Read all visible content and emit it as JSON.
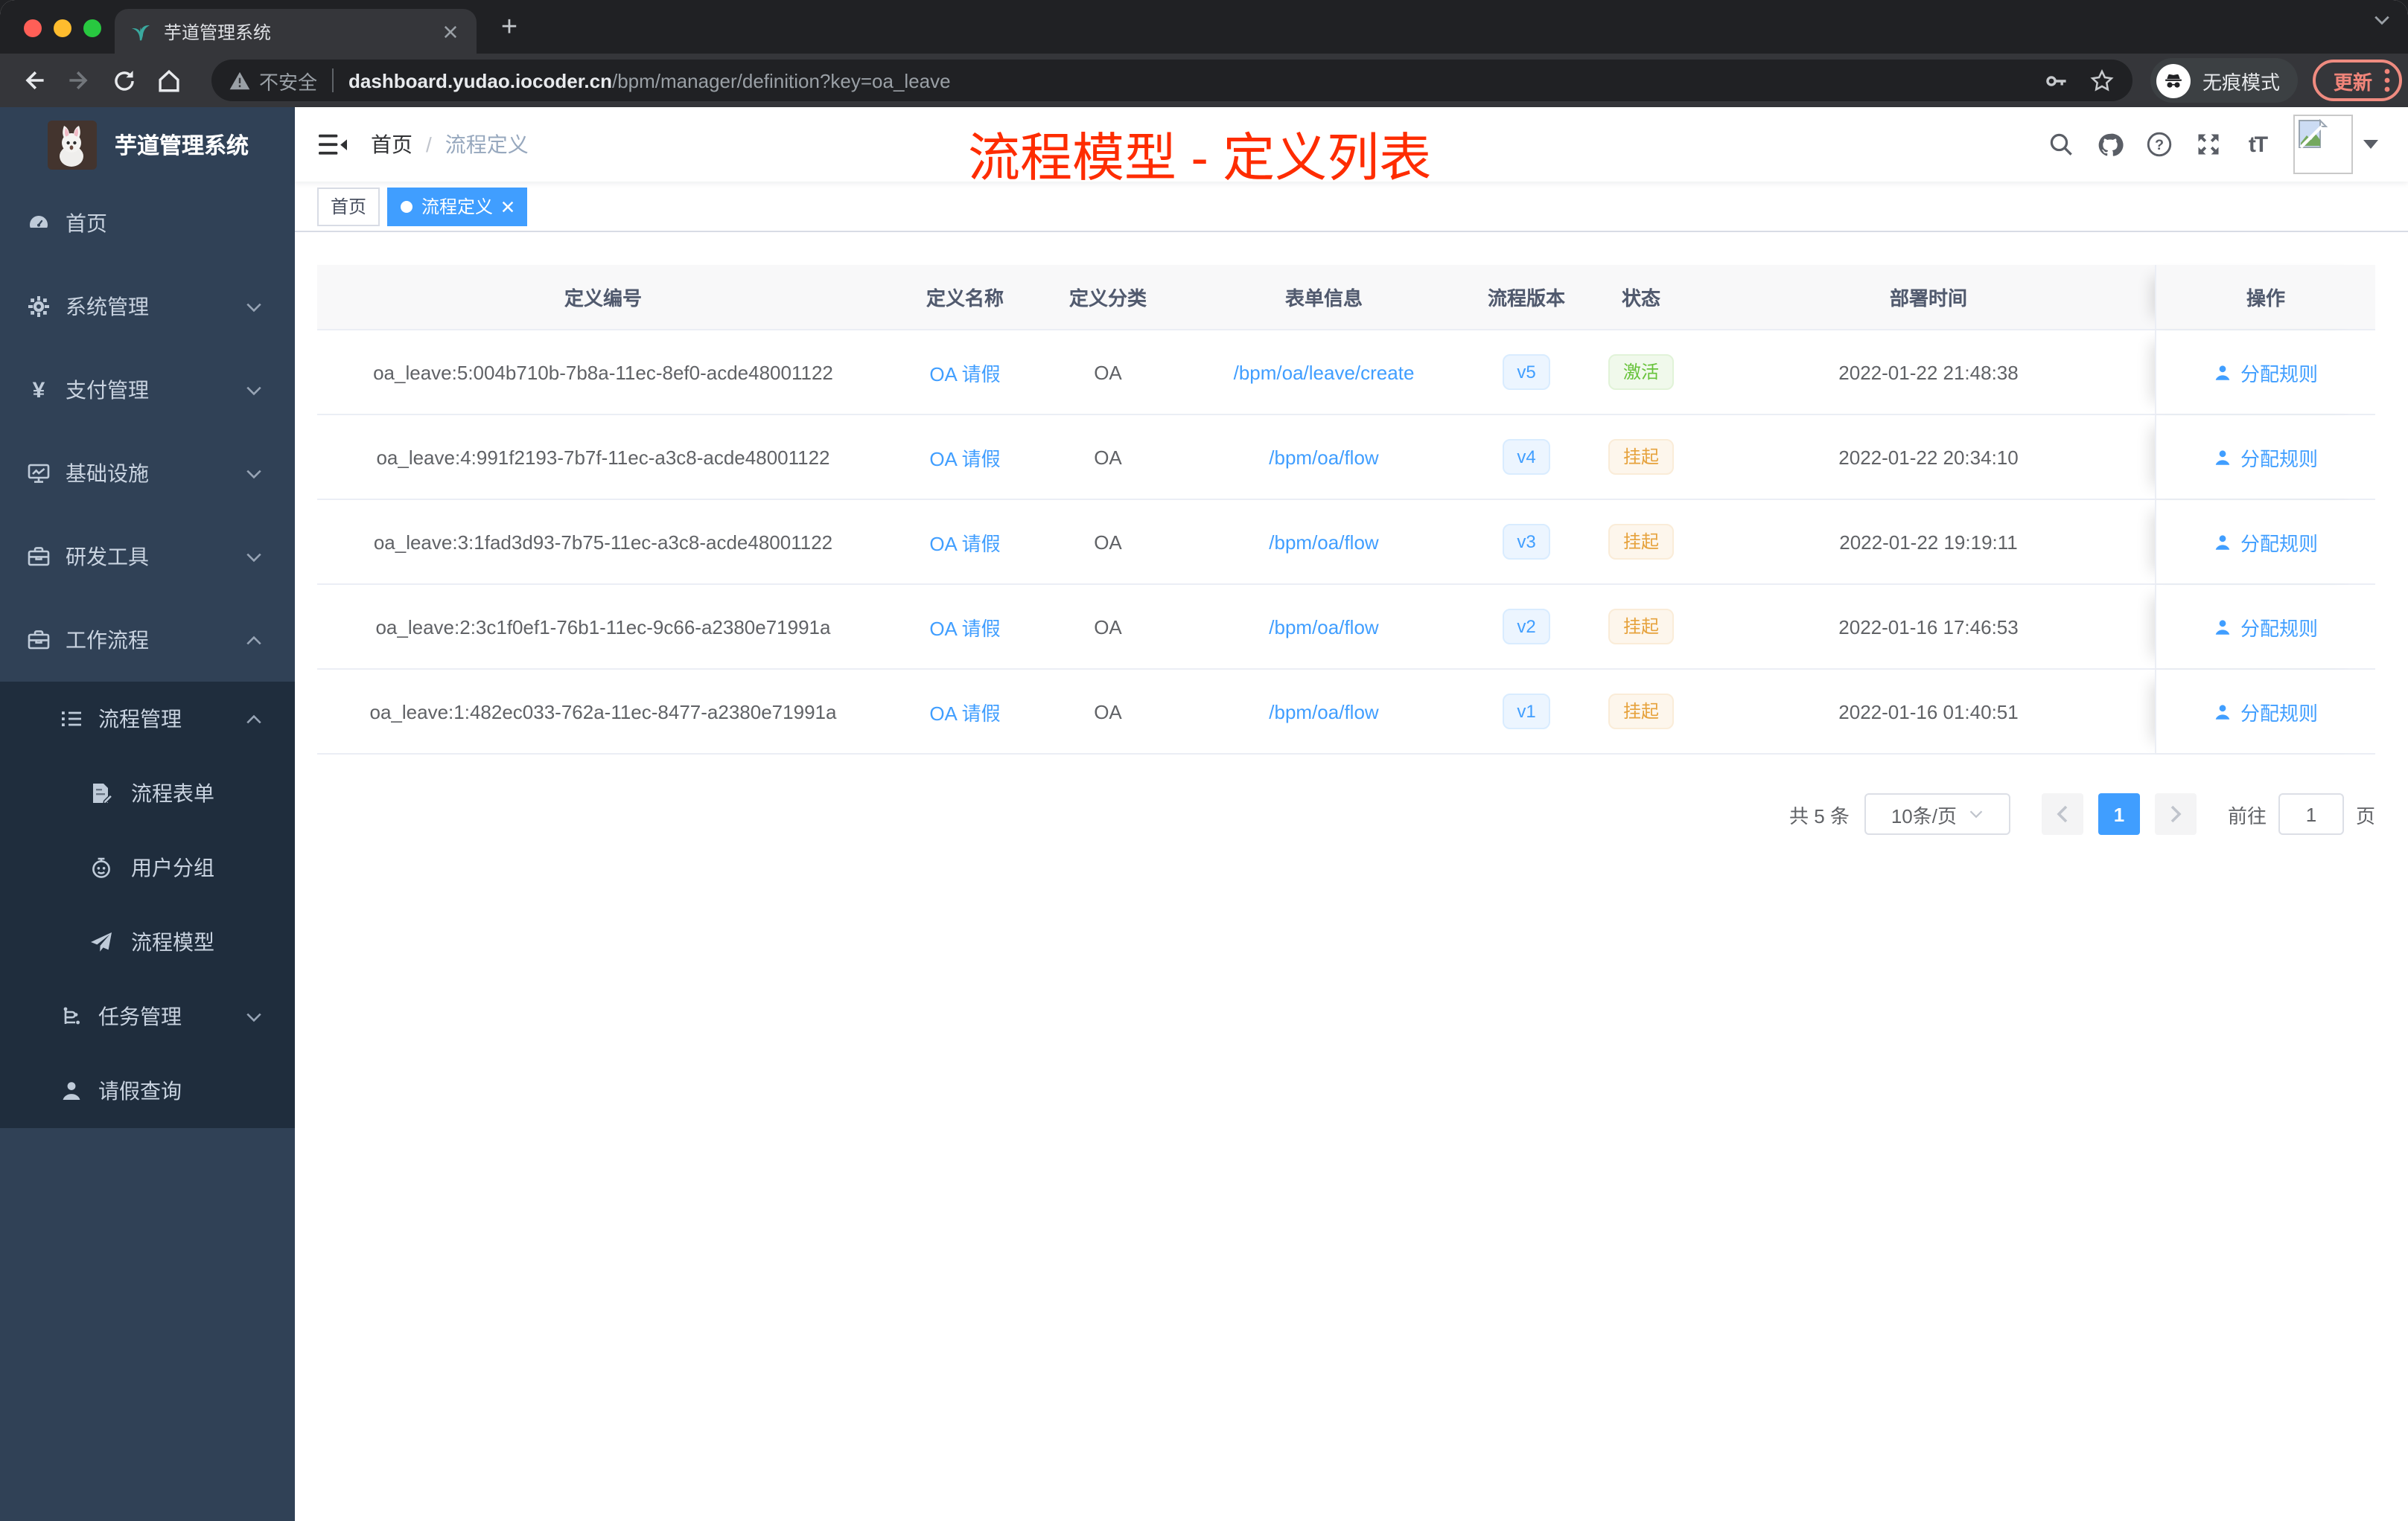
{
  "browser": {
    "tab_title": "芋道管理系统",
    "security_label": "不安全",
    "url_domain": "dashboard.yudao.iocoder.cn",
    "url_path": "/bpm/manager/definition?key=oa_leave",
    "incognito_label": "无痕模式",
    "update_label": "更新"
  },
  "sidebar": {
    "app_title": "芋道管理系统",
    "items": [
      {
        "label": "首页",
        "icon": "dashboard-icon"
      },
      {
        "label": "系统管理",
        "icon": "gear-icon",
        "expand": "down"
      },
      {
        "label": "支付管理",
        "icon": "yen-icon",
        "expand": "down"
      },
      {
        "label": "基础设施",
        "icon": "monitor-icon",
        "expand": "down"
      },
      {
        "label": "研发工具",
        "icon": "toolbox-icon",
        "expand": "down"
      },
      {
        "label": "工作流程",
        "icon": "briefcase-icon",
        "expand": "up"
      }
    ],
    "workflow_children": [
      {
        "label": "流程管理",
        "icon": "list-icon",
        "expand": "up"
      },
      {
        "label": "流程表单",
        "icon": "form-icon"
      },
      {
        "label": "用户分组",
        "icon": "robot-icon"
      },
      {
        "label": "流程模型",
        "icon": "paper-plane-icon"
      },
      {
        "label": "任务管理",
        "icon": "tree-icon",
        "expand": "down"
      },
      {
        "label": "请假查询",
        "icon": "user-icon"
      }
    ]
  },
  "navbar": {
    "breadcrumb_home": "首页",
    "breadcrumb_sep": "/",
    "breadcrumb_current": "流程定义",
    "font_icon_label": "tT"
  },
  "annotation": {
    "text": "流程模型 - 定义列表",
    "color": "#fe2c00"
  },
  "tags": [
    {
      "label": "首页"
    },
    {
      "label": "流程定义"
    }
  ],
  "table": {
    "columns": [
      "定义编号",
      "定义名称",
      "定义分类",
      "表单信息",
      "流程版本",
      "状态",
      "部署时间",
      "操作"
    ],
    "rows": [
      {
        "id": "oa_leave:5:004b710b-7b8a-11ec-8ef0-acde48001122",
        "name": "OA 请假",
        "category": "OA",
        "form": "/bpm/oa/leave/create",
        "version": "v5",
        "status": "激活",
        "status_type": "success",
        "time": "2022-01-22 21:48:38",
        "action": "分配规则"
      },
      {
        "id": "oa_leave:4:991f2193-7b7f-11ec-a3c8-acde48001122",
        "name": "OA 请假",
        "category": "OA",
        "form": "/bpm/oa/flow",
        "version": "v4",
        "status": "挂起",
        "status_type": "warning",
        "time": "2022-01-22 20:34:10",
        "action": "分配规则"
      },
      {
        "id": "oa_leave:3:1fad3d93-7b75-11ec-a3c8-acde48001122",
        "name": "OA 请假",
        "category": "OA",
        "form": "/bpm/oa/flow",
        "version": "v3",
        "status": "挂起",
        "status_type": "warning",
        "time": "2022-01-22 19:19:11",
        "action": "分配规则"
      },
      {
        "id": "oa_leave:2:3c1f0ef1-76b1-11ec-9c66-a2380e71991a",
        "name": "OA 请假",
        "category": "OA",
        "form": "/bpm/oa/flow",
        "version": "v2",
        "status": "挂起",
        "status_type": "warning",
        "time": "2022-01-16 17:46:53",
        "action": "分配规则"
      },
      {
        "id": "oa_leave:1:482ec033-762a-11ec-8477-a2380e71991a",
        "name": "OA 请假",
        "category": "OA",
        "form": "/bpm/oa/flow",
        "version": "v1",
        "status": "挂起",
        "status_type": "warning",
        "time": "2022-01-16 01:40:51",
        "action": "分配规则"
      }
    ]
  },
  "pagination": {
    "total": "共 5 条",
    "page_size": "10条/页",
    "page": "1",
    "goto_label": "前往",
    "goto_value": "1",
    "unit_label": "页"
  },
  "colors": {
    "accent_blue": "#409eff",
    "success_green": "#67c23a",
    "warning_orange": "#e6a23c",
    "annotation_red": "#fe2c00",
    "sidebar_bg": "#304156",
    "submenu_bg": "#1f2d3d",
    "chrome_dark": "#202124",
    "chrome_mid": "#35363a",
    "update_coral": "#f28b82"
  }
}
